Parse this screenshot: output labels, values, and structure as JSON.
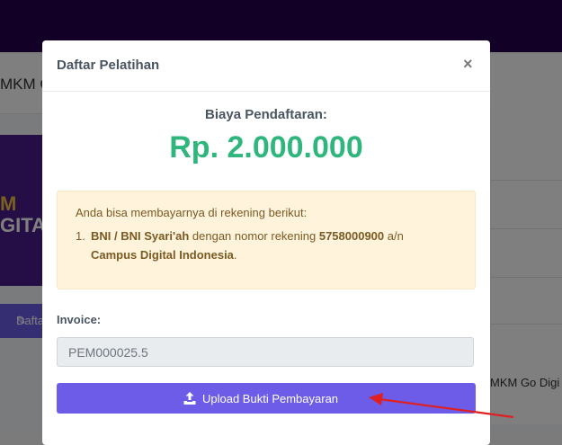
{
  "background": {
    "header_title": "MKM Go",
    "banner_line1": "M",
    "banner_line2": "GITAL",
    "register_button": "Dafta",
    "right_text": "MKM Go Digi"
  },
  "modal": {
    "title": "Daftar Pelatihan",
    "close": "×",
    "fee_label": "Biaya Pendaftaran:",
    "fee_amount": "Rp. 2.000.000",
    "info": {
      "intro": "Anda bisa membayarnya di rekening berikut:",
      "item_number": "1.",
      "bank": "BNI / BNI Syari'ah",
      "middle": " dengan nomor rekening ",
      "account_number": "5758000900",
      "an": " a/n",
      "account_name": "Campus Digital Indonesia",
      "period": "."
    },
    "invoice_label": "Invoice:",
    "invoice_value": "PEM000025.5",
    "upload_button": "Upload Bukti Pembayaran"
  },
  "colors": {
    "accent": "#6c5ce7",
    "amount": "#2fb67c",
    "alert_bg": "#fff3dc",
    "annotation_arrow": "#e02020"
  }
}
